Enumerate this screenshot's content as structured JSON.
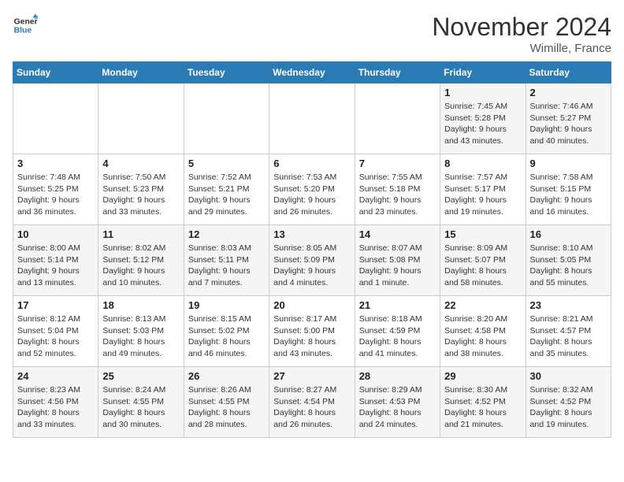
{
  "header": {
    "logo_line1": "General",
    "logo_line2": "Blue",
    "month": "November 2024",
    "location": "Wimille, France"
  },
  "days_of_week": [
    "Sunday",
    "Monday",
    "Tuesday",
    "Wednesday",
    "Thursday",
    "Friday",
    "Saturday"
  ],
  "weeks": [
    [
      {
        "day": "",
        "info": ""
      },
      {
        "day": "",
        "info": ""
      },
      {
        "day": "",
        "info": ""
      },
      {
        "day": "",
        "info": ""
      },
      {
        "day": "",
        "info": ""
      },
      {
        "day": "1",
        "info": "Sunrise: 7:45 AM\nSunset: 5:28 PM\nDaylight: 9 hours and 43 minutes."
      },
      {
        "day": "2",
        "info": "Sunrise: 7:46 AM\nSunset: 5:27 PM\nDaylight: 9 hours and 40 minutes."
      }
    ],
    [
      {
        "day": "3",
        "info": "Sunrise: 7:48 AM\nSunset: 5:25 PM\nDaylight: 9 hours and 36 minutes."
      },
      {
        "day": "4",
        "info": "Sunrise: 7:50 AM\nSunset: 5:23 PM\nDaylight: 9 hours and 33 minutes."
      },
      {
        "day": "5",
        "info": "Sunrise: 7:52 AM\nSunset: 5:21 PM\nDaylight: 9 hours and 29 minutes."
      },
      {
        "day": "6",
        "info": "Sunrise: 7:53 AM\nSunset: 5:20 PM\nDaylight: 9 hours and 26 minutes."
      },
      {
        "day": "7",
        "info": "Sunrise: 7:55 AM\nSunset: 5:18 PM\nDaylight: 9 hours and 23 minutes."
      },
      {
        "day": "8",
        "info": "Sunrise: 7:57 AM\nSunset: 5:17 PM\nDaylight: 9 hours and 19 minutes."
      },
      {
        "day": "9",
        "info": "Sunrise: 7:58 AM\nSunset: 5:15 PM\nDaylight: 9 hours and 16 minutes."
      }
    ],
    [
      {
        "day": "10",
        "info": "Sunrise: 8:00 AM\nSunset: 5:14 PM\nDaylight: 9 hours and 13 minutes."
      },
      {
        "day": "11",
        "info": "Sunrise: 8:02 AM\nSunset: 5:12 PM\nDaylight: 9 hours and 10 minutes."
      },
      {
        "day": "12",
        "info": "Sunrise: 8:03 AM\nSunset: 5:11 PM\nDaylight: 9 hours and 7 minutes."
      },
      {
        "day": "13",
        "info": "Sunrise: 8:05 AM\nSunset: 5:09 PM\nDaylight: 9 hours and 4 minutes."
      },
      {
        "day": "14",
        "info": "Sunrise: 8:07 AM\nSunset: 5:08 PM\nDaylight: 9 hours and 1 minute."
      },
      {
        "day": "15",
        "info": "Sunrise: 8:09 AM\nSunset: 5:07 PM\nDaylight: 8 hours and 58 minutes."
      },
      {
        "day": "16",
        "info": "Sunrise: 8:10 AM\nSunset: 5:05 PM\nDaylight: 8 hours and 55 minutes."
      }
    ],
    [
      {
        "day": "17",
        "info": "Sunrise: 8:12 AM\nSunset: 5:04 PM\nDaylight: 8 hours and 52 minutes."
      },
      {
        "day": "18",
        "info": "Sunrise: 8:13 AM\nSunset: 5:03 PM\nDaylight: 8 hours and 49 minutes."
      },
      {
        "day": "19",
        "info": "Sunrise: 8:15 AM\nSunset: 5:02 PM\nDaylight: 8 hours and 46 minutes."
      },
      {
        "day": "20",
        "info": "Sunrise: 8:17 AM\nSunset: 5:00 PM\nDaylight: 8 hours and 43 minutes."
      },
      {
        "day": "21",
        "info": "Sunrise: 8:18 AM\nSunset: 4:59 PM\nDaylight: 8 hours and 41 minutes."
      },
      {
        "day": "22",
        "info": "Sunrise: 8:20 AM\nSunset: 4:58 PM\nDaylight: 8 hours and 38 minutes."
      },
      {
        "day": "23",
        "info": "Sunrise: 8:21 AM\nSunset: 4:57 PM\nDaylight: 8 hours and 35 minutes."
      }
    ],
    [
      {
        "day": "24",
        "info": "Sunrise: 8:23 AM\nSunset: 4:56 PM\nDaylight: 8 hours and 33 minutes."
      },
      {
        "day": "25",
        "info": "Sunrise: 8:24 AM\nSunset: 4:55 PM\nDaylight: 8 hours and 30 minutes."
      },
      {
        "day": "26",
        "info": "Sunrise: 8:26 AM\nSunset: 4:55 PM\nDaylight: 8 hours and 28 minutes."
      },
      {
        "day": "27",
        "info": "Sunrise: 8:27 AM\nSunset: 4:54 PM\nDaylight: 8 hours and 26 minutes."
      },
      {
        "day": "28",
        "info": "Sunrise: 8:29 AM\nSunset: 4:53 PM\nDaylight: 8 hours and 24 minutes."
      },
      {
        "day": "29",
        "info": "Sunrise: 8:30 AM\nSunset: 4:52 PM\nDaylight: 8 hours and 21 minutes."
      },
      {
        "day": "30",
        "info": "Sunrise: 8:32 AM\nSunset: 4:52 PM\nDaylight: 8 hours and 19 minutes."
      }
    ]
  ]
}
